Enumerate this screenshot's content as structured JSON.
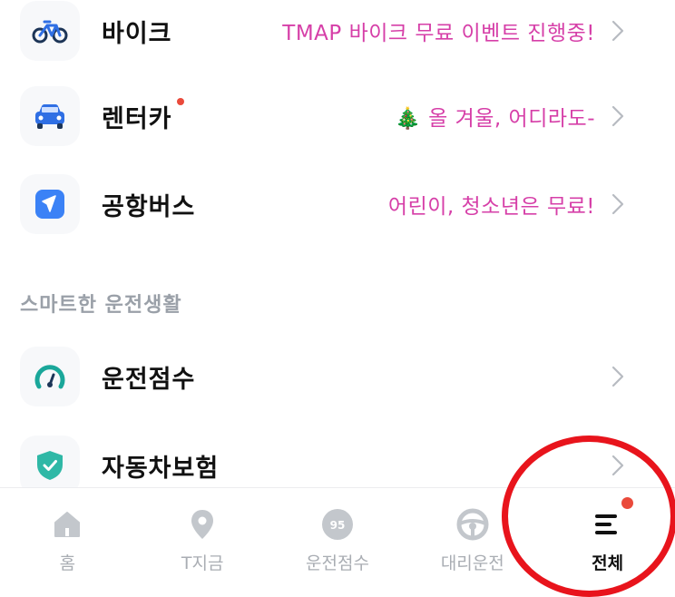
{
  "rows": [
    {
      "icon": "bike-icon",
      "title": "바이크",
      "promo": "TMAP 바이크 무료 이벤트 진행중!",
      "has_dot": false
    },
    {
      "icon": "car-icon",
      "title": "렌터카",
      "promo": "🎄 올 겨울, 어디라도-",
      "has_dot": true
    },
    {
      "icon": "airplane-icon",
      "title": "공항버스",
      "promo": "어린이, 청소년은 무료!",
      "has_dot": false
    }
  ],
  "section": {
    "label": "스마트한 운전생활"
  },
  "section_rows": [
    {
      "icon": "speedometer-icon",
      "title": "운전점수",
      "promo": ""
    },
    {
      "icon": "shield-check-icon",
      "title": "자동차보험",
      "promo": ""
    }
  ],
  "tabbar": {
    "tabs": [
      {
        "icon": "home-icon",
        "label": "홈",
        "active": false
      },
      {
        "icon": "location-pin-icon",
        "label": "T지금",
        "active": false
      },
      {
        "icon": "score-gauge-icon",
        "label": "운전점수",
        "active": false,
        "icon_text": "95"
      },
      {
        "icon": "steering-wheel-icon",
        "label": "대리운전",
        "active": false
      },
      {
        "icon": "menu-icon",
        "label": "전체",
        "active": true,
        "has_dot": true
      }
    ]
  },
  "colors": {
    "promo": "#d63fa8",
    "badge": "#ea4a3b",
    "highlight": "#e8141c",
    "bike_icon": "#1d3557",
    "car_icon": "#2f6fe4",
    "airplane_icon": "#3b82f6",
    "speedometer_icon": "#1aa79a",
    "shield_icon": "#2fb8a6"
  }
}
